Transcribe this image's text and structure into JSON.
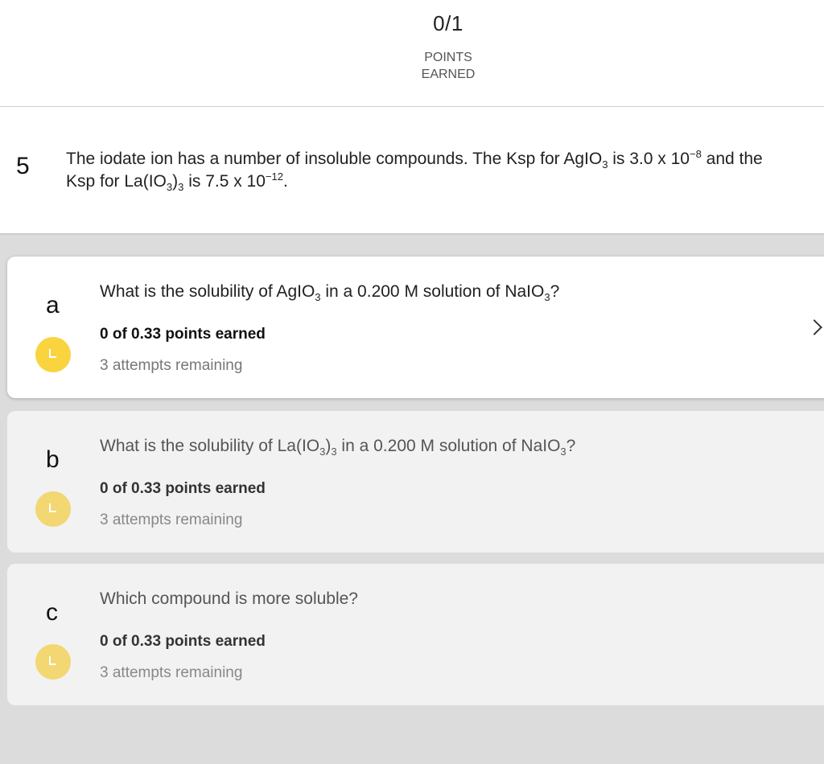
{
  "score": {
    "value": "0/1",
    "label_line1": "POINTS",
    "label_line2": "EARNED"
  },
  "question": {
    "number": "5",
    "prompt": {
      "p1": "The iodate ion has a number of insoluble compounds. The Ksp for AgIO",
      "sub1": "3",
      "p2": " is 3.0 x 10",
      "sup1": "−8",
      "p3": " and the Ksp for La(IO",
      "sub2": "3",
      "p4": ")",
      "sub3": "3",
      "p5": " is 7.5 x 10",
      "sup2": "−12",
      "p6": "."
    }
  },
  "parts": [
    {
      "letter": "a",
      "q1": "What is the solubility of AgIO",
      "s1": "3",
      "q2": " in a 0.200 M solution of NaIO",
      "s2": "3",
      "q3": "?",
      "points": "0 of 0.33 points earned",
      "attempts": "3 attempts remaining"
    },
    {
      "letter": "b",
      "q1": "What is the solubility of La(IO",
      "s1": "3",
      "q2": ")",
      "s2": "3",
      "q3": " in a 0.200 M solution of NaIO",
      "s3": "3",
      "q4": "?",
      "points": "0 of 0.33 points earned",
      "attempts": "3 attempts remaining"
    },
    {
      "letter": "c",
      "q1": "Which compound is more soluble?",
      "points": "0 of 0.33 points earned",
      "attempts": "3 attempts remaining"
    }
  ],
  "icons": {
    "badge": "in-progress-icon",
    "chevron": "chevron-right-icon"
  },
  "colors": {
    "badge_active": "#f9d43f",
    "badge_inactive": "#f2d772"
  }
}
